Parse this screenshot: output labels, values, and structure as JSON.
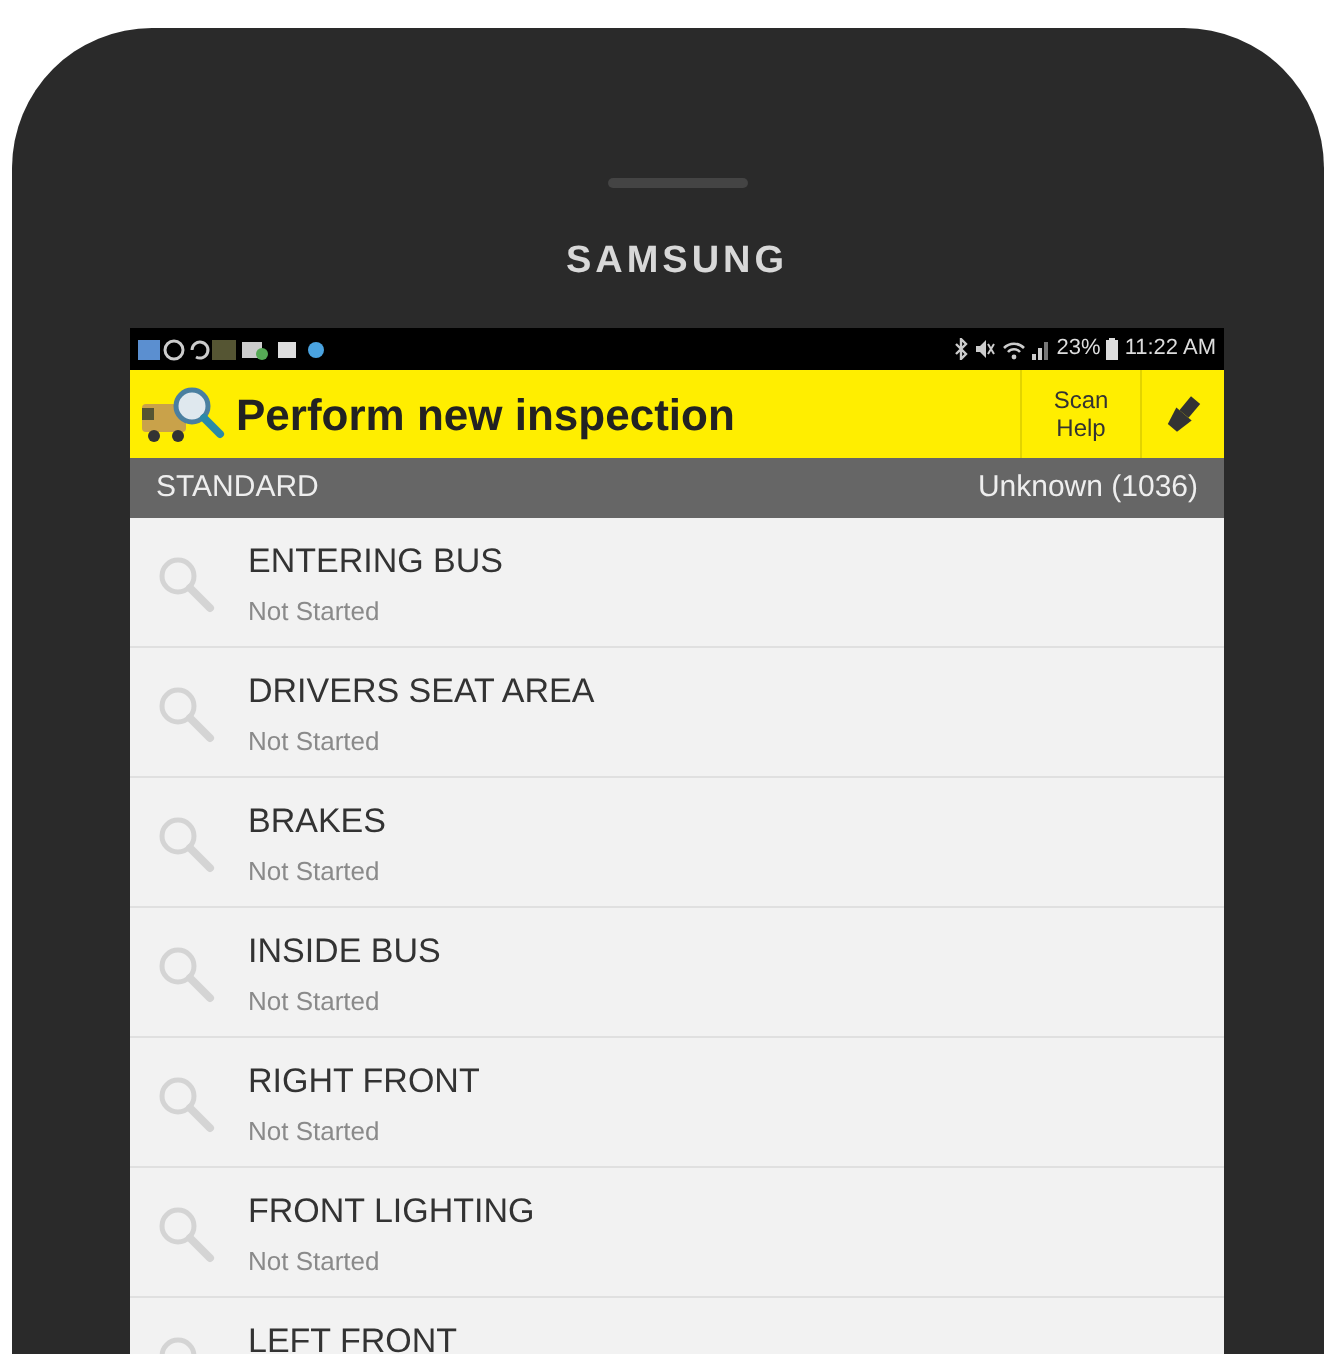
{
  "device": {
    "brand": "SAMSUNG"
  },
  "status_bar": {
    "battery": "23%",
    "time": "11:22 AM"
  },
  "app_bar": {
    "title": "Perform new inspection",
    "scan_help": [
      "Scan",
      "Help"
    ]
  },
  "subheader": {
    "left": "STANDARD",
    "right": "Unknown (1036)"
  },
  "sections": [
    {
      "title": "ENTERING BUS",
      "status": "Not Started"
    },
    {
      "title": "DRIVERS SEAT AREA",
      "status": "Not Started"
    },
    {
      "title": "BRAKES",
      "status": "Not Started"
    },
    {
      "title": "INSIDE BUS",
      "status": "Not Started"
    },
    {
      "title": "RIGHT FRONT",
      "status": "Not Started"
    },
    {
      "title": "FRONT LIGHTING",
      "status": "Not Started"
    },
    {
      "title": "LEFT FRONT"
    }
  ]
}
